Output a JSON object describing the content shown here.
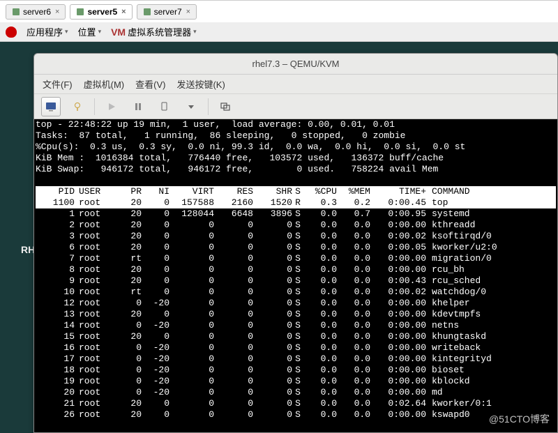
{
  "browser_tabs": {
    "items": [
      {
        "label": "server6",
        "active": false
      },
      {
        "label": "server5",
        "active": true
      },
      {
        "label": "server7",
        "active": false
      }
    ]
  },
  "desktop": {
    "menu1": "应用程序",
    "menu2": "位置",
    "menu3": "虚拟系统管理器"
  },
  "titlebar": "rhel7.3 – QEMU/KVM",
  "menubar": {
    "file": "文件(F)",
    "vm": "虚拟机(M)",
    "view": "查看(V)",
    "send": "发送按键(K)"
  },
  "side_label": "RH",
  "watermark": "@51CTO博客",
  "top_summary": [
    "top - 22:48:22 up 19 min,  1 user,  load average: 0.00, 0.01, 0.01",
    "Tasks:  87 total,   1 running,  86 sleeping,   0 stopped,   0 zombie",
    "%Cpu(s):  0.3 us,  0.3 sy,  0.0 ni, 99.3 id,  0.0 wa,  0.0 hi,  0.0 si,  0.0 st",
    "KiB Mem :  1016384 total,   776440 free,   103572 used,   136372 buff/cache",
    "KiB Swap:   946172 total,   946172 free,        0 used.   758224 avail Mem"
  ],
  "top_header": {
    "pid": "PID",
    "user": "USER",
    "pr": "PR",
    "ni": "NI",
    "virt": "VIRT",
    "res": "RES",
    "shr": "SHR",
    "s": "S",
    "cpu": "%CPU",
    "mem": "%MEM",
    "time": "TIME+",
    "cmd": "COMMAND"
  },
  "top_rows": [
    {
      "pid": "1100",
      "user": "root",
      "pr": "20",
      "ni": "0",
      "virt": "157588",
      "res": "2160",
      "shr": "1520",
      "s": "R",
      "cpu": "0.3",
      "mem": "0.2",
      "time": "0:00.45",
      "cmd": "top",
      "hl": true
    },
    {
      "pid": "1",
      "user": "root",
      "pr": "20",
      "ni": "0",
      "virt": "128044",
      "res": "6648",
      "shr": "3896",
      "s": "S",
      "cpu": "0.0",
      "mem": "0.7",
      "time": "0:00.95",
      "cmd": "systemd"
    },
    {
      "pid": "2",
      "user": "root",
      "pr": "20",
      "ni": "0",
      "virt": "0",
      "res": "0",
      "shr": "0",
      "s": "S",
      "cpu": "0.0",
      "mem": "0.0",
      "time": "0:00.00",
      "cmd": "kthreadd"
    },
    {
      "pid": "3",
      "user": "root",
      "pr": "20",
      "ni": "0",
      "virt": "0",
      "res": "0",
      "shr": "0",
      "s": "S",
      "cpu": "0.0",
      "mem": "0.0",
      "time": "0:00.02",
      "cmd": "ksoftirqd/0"
    },
    {
      "pid": "6",
      "user": "root",
      "pr": "20",
      "ni": "0",
      "virt": "0",
      "res": "0",
      "shr": "0",
      "s": "S",
      "cpu": "0.0",
      "mem": "0.0",
      "time": "0:00.05",
      "cmd": "kworker/u2:0"
    },
    {
      "pid": "7",
      "user": "root",
      "pr": "rt",
      "ni": "0",
      "virt": "0",
      "res": "0",
      "shr": "0",
      "s": "S",
      "cpu": "0.0",
      "mem": "0.0",
      "time": "0:00.00",
      "cmd": "migration/0"
    },
    {
      "pid": "8",
      "user": "root",
      "pr": "20",
      "ni": "0",
      "virt": "0",
      "res": "0",
      "shr": "0",
      "s": "S",
      "cpu": "0.0",
      "mem": "0.0",
      "time": "0:00.00",
      "cmd": "rcu_bh"
    },
    {
      "pid": "9",
      "user": "root",
      "pr": "20",
      "ni": "0",
      "virt": "0",
      "res": "0",
      "shr": "0",
      "s": "S",
      "cpu": "0.0",
      "mem": "0.0",
      "time": "0:00.43",
      "cmd": "rcu_sched"
    },
    {
      "pid": "10",
      "user": "root",
      "pr": "rt",
      "ni": "0",
      "virt": "0",
      "res": "0",
      "shr": "0",
      "s": "S",
      "cpu": "0.0",
      "mem": "0.0",
      "time": "0:00.02",
      "cmd": "watchdog/0"
    },
    {
      "pid": "12",
      "user": "root",
      "pr": "0",
      "ni": "-20",
      "virt": "0",
      "res": "0",
      "shr": "0",
      "s": "S",
      "cpu": "0.0",
      "mem": "0.0",
      "time": "0:00.00",
      "cmd": "khelper"
    },
    {
      "pid": "13",
      "user": "root",
      "pr": "20",
      "ni": "0",
      "virt": "0",
      "res": "0",
      "shr": "0",
      "s": "S",
      "cpu": "0.0",
      "mem": "0.0",
      "time": "0:00.00",
      "cmd": "kdevtmpfs"
    },
    {
      "pid": "14",
      "user": "root",
      "pr": "0",
      "ni": "-20",
      "virt": "0",
      "res": "0",
      "shr": "0",
      "s": "S",
      "cpu": "0.0",
      "mem": "0.0",
      "time": "0:00.00",
      "cmd": "netns"
    },
    {
      "pid": "15",
      "user": "root",
      "pr": "20",
      "ni": "0",
      "virt": "0",
      "res": "0",
      "shr": "0",
      "s": "S",
      "cpu": "0.0",
      "mem": "0.0",
      "time": "0:00.00",
      "cmd": "khungtaskd"
    },
    {
      "pid": "16",
      "user": "root",
      "pr": "0",
      "ni": "-20",
      "virt": "0",
      "res": "0",
      "shr": "0",
      "s": "S",
      "cpu": "0.0",
      "mem": "0.0",
      "time": "0:00.00",
      "cmd": "writeback"
    },
    {
      "pid": "17",
      "user": "root",
      "pr": "0",
      "ni": "-20",
      "virt": "0",
      "res": "0",
      "shr": "0",
      "s": "S",
      "cpu": "0.0",
      "mem": "0.0",
      "time": "0:00.00",
      "cmd": "kintegrityd"
    },
    {
      "pid": "18",
      "user": "root",
      "pr": "0",
      "ni": "-20",
      "virt": "0",
      "res": "0",
      "shr": "0",
      "s": "S",
      "cpu": "0.0",
      "mem": "0.0",
      "time": "0:00.00",
      "cmd": "bioset"
    },
    {
      "pid": "19",
      "user": "root",
      "pr": "0",
      "ni": "-20",
      "virt": "0",
      "res": "0",
      "shr": "0",
      "s": "S",
      "cpu": "0.0",
      "mem": "0.0",
      "time": "0:00.00",
      "cmd": "kblockd"
    },
    {
      "pid": "20",
      "user": "root",
      "pr": "0",
      "ni": "-20",
      "virt": "0",
      "res": "0",
      "shr": "0",
      "s": "S",
      "cpu": "0.0",
      "mem": "0.0",
      "time": "0:00.00",
      "cmd": "md"
    },
    {
      "pid": "21",
      "user": "root",
      "pr": "20",
      "ni": "0",
      "virt": "0",
      "res": "0",
      "shr": "0",
      "s": "S",
      "cpu": "0.0",
      "mem": "0.0",
      "time": "0:02.64",
      "cmd": "kworker/0:1"
    },
    {
      "pid": "26",
      "user": "root",
      "pr": "20",
      "ni": "0",
      "virt": "0",
      "res": "0",
      "shr": "0",
      "s": "S",
      "cpu": "0.0",
      "mem": "0.0",
      "time": "0:00.00",
      "cmd": "kswapd0"
    }
  ]
}
